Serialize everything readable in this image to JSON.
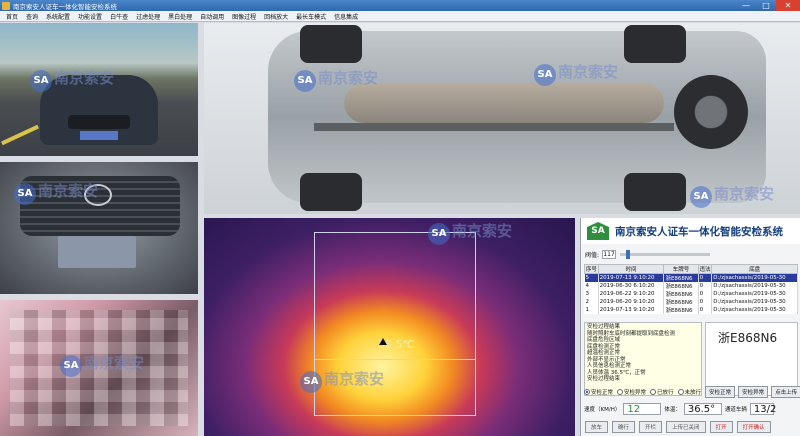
{
  "window": {
    "title": "南京索安人证车一体化智能安检系统",
    "minimize": "—",
    "maximize": "□",
    "close": "✕"
  },
  "menu": [
    "首页",
    "查询",
    "系统配置",
    "功能设置",
    "白牛查",
    "过虑处理",
    "黑白处理",
    "自动调用",
    "图像过程",
    "回档放大",
    "最长车模式",
    "信息集成"
  ],
  "watermark": {
    "badge": "SA",
    "text": "南京索安"
  },
  "thermal": {
    "temperature": "36.5℃"
  },
  "brand": {
    "logo": "SA",
    "name": "南京索安人证车一体化智能安检系统"
  },
  "threshold": {
    "label": "阀值:",
    "value": "117"
  },
  "table": {
    "headers": [
      "序号",
      "时间",
      "车牌号",
      "违法",
      "底盘"
    ],
    "rows": [
      [
        "5",
        "2019-07-13 9:10:20",
        "浙E868N6",
        "0",
        "D:/zjsachassis/2019-05-30"
      ],
      [
        "4",
        "2019-06-30 6:10:20",
        "浙E868N6",
        "0",
        "D:/zjsachassis/2019-05-30"
      ],
      [
        "3",
        "2019-06-22 9:10:20",
        "浙E868N6",
        "0",
        "D:/zjsachassis/2019-05-30"
      ],
      [
        "2",
        "2019-06-20 9:10:20",
        "浙E868N6",
        "0",
        "D:/zjsachassis/2019-05-30"
      ],
      [
        "1",
        "2019-07-13 9:10:20",
        "浙E868N6",
        "0",
        "D:/zjsachassis/2019-05-30"
      ]
    ]
  },
  "log": [
    "安检过程结果",
    "随时照射车底时刻都提取到底盘检测",
    "底盘危险区域",
    "底盘检测正常",
    "超温检测正常",
    "外部不显示正常",
    "人员信息检测正常",
    "人员体温 36.5℃，正常",
    "安检过程结束"
  ],
  "plate": {
    "text": "浙E868N6"
  },
  "options": {
    "radios": [
      "安检正常",
      "安检异常",
      "已放行",
      "未放行"
    ],
    "buttons": [
      "安检正常",
      "安检异常",
      "点击上传"
    ]
  },
  "speed": {
    "speed_label": "速度（KM/H）",
    "speed_value": "12",
    "temp_label": "体温：",
    "temp_value": "36.5°",
    "count_label": "通道车辆",
    "count_value": "13/2"
  },
  "buttons": [
    "放车",
    "确行",
    "开栏",
    "上传已关闭",
    "打开",
    "打开确认"
  ]
}
